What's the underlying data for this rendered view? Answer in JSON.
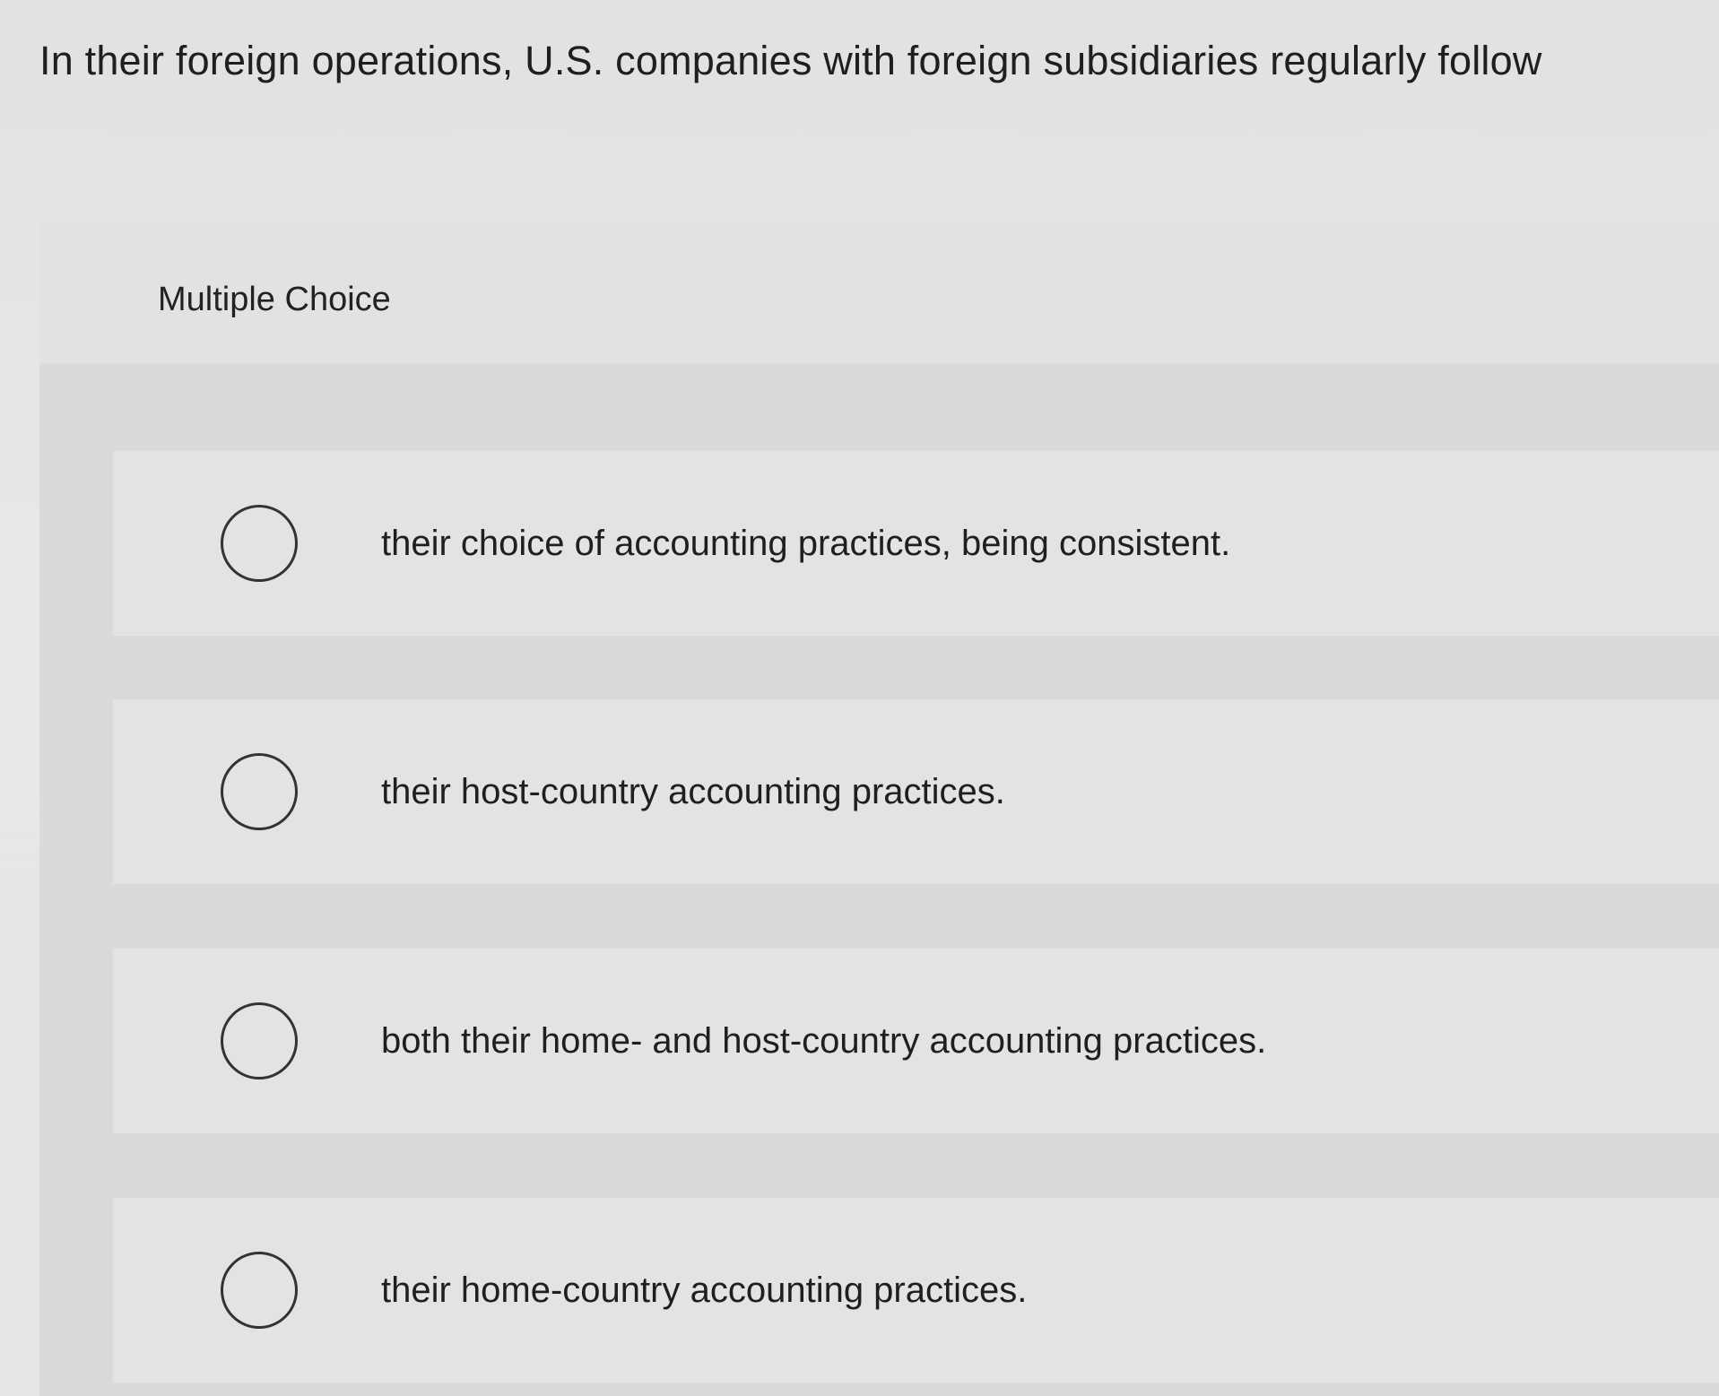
{
  "question": {
    "text": "In their foreign operations, U.S. companies with foreign subsidiaries regularly follow"
  },
  "panel": {
    "title": "Multiple Choice"
  },
  "options": [
    {
      "label": "their choice of accounting practices, being consistent.",
      "selected": false
    },
    {
      "label": "their host-country accounting practices.",
      "selected": false
    },
    {
      "label": "both their home- and host-country accounting practices.",
      "selected": false
    },
    {
      "label": "their home-country accounting practices.",
      "selected": false
    }
  ]
}
